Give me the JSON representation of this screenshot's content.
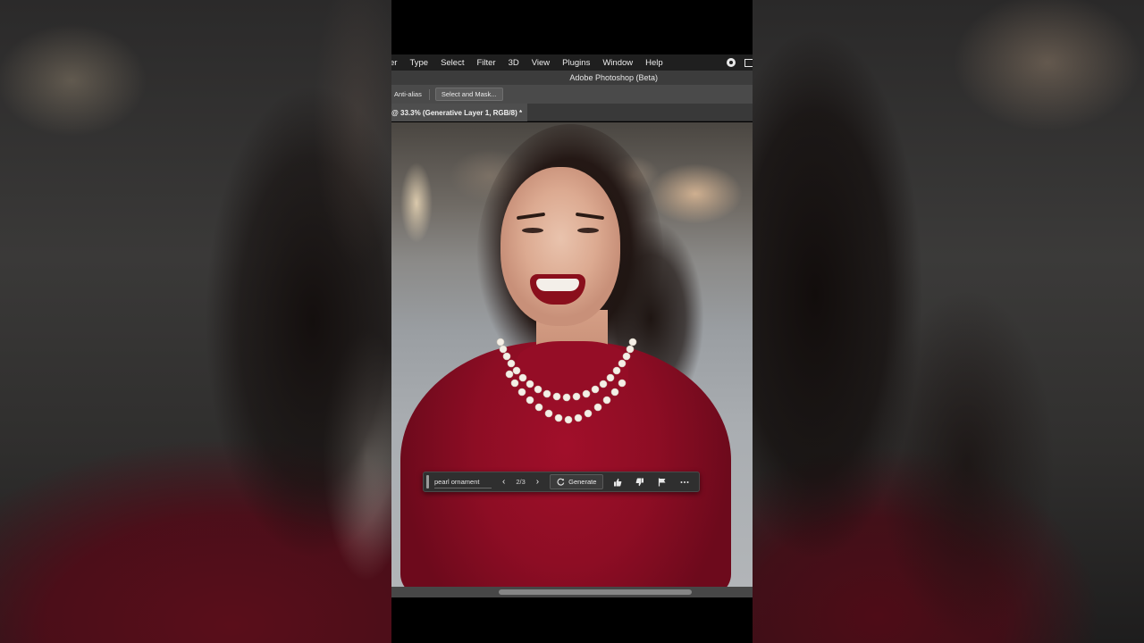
{
  "menu": {
    "items": [
      "er",
      "Type",
      "Select",
      "Filter",
      "3D",
      "View",
      "Plugins",
      "Window",
      "Help"
    ]
  },
  "app": {
    "title": "Adobe Photoshop (Beta)"
  },
  "options": {
    "anti_alias_label": "Anti-alias",
    "select_mask_label": "Select and Mask..."
  },
  "document": {
    "tab_label": "@ 33.3% (Generative Layer 1, RGB/8) *"
  },
  "taskbar": {
    "prompt_value": "pearl ornament",
    "variation_counter": "2/3",
    "generate_label": "Generate"
  },
  "icons": {
    "record": "record-icon",
    "window": "window-icon",
    "prev": "chevron-left-icon",
    "next": "chevron-right-icon",
    "regenerate": "refresh-icon",
    "like": "thumbs-up-icon",
    "dislike": "thumbs-down-icon",
    "report": "flag-icon",
    "more": "more-icon"
  },
  "colors": {
    "menubar_bg": "#1f1f1f",
    "options_bg": "#4a4a4a",
    "taskbar_bg": "#2f2f2f"
  }
}
